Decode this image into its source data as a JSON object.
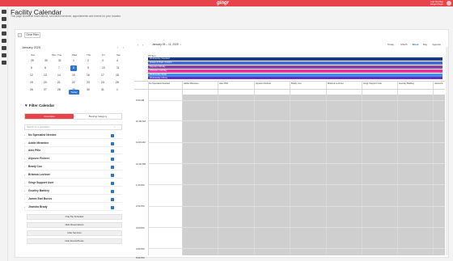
{
  "topbar": {
    "logo": "gingr",
    "user_name": "Lisa Test Rep",
    "user_org": "Ginger Pinger"
  },
  "sidebar": {
    "icons": [
      "home-icon",
      "calendar-icon",
      "paw-icon",
      "inbox-icon",
      "card-icon",
      "chart-icon",
      "heart-icon",
      "settings-icon"
    ]
  },
  "page": {
    "title": "Facility Calendar",
    "subtitle": "This page shows all reservations, scheduled services, appointments and events for your location."
  },
  "toolbar": {
    "expand_label": "›",
    "clear_filter_label": "Clear Filter"
  },
  "mini_calendar": {
    "month_label": "January 2025",
    "prev_glyph": "‹",
    "next_glyph": "›",
    "weekdays": [
      "Sun",
      "Mon",
      "Tue",
      "Wed",
      "Thu",
      "Fri",
      "Sat"
    ],
    "weeks": [
      [
        "29",
        "30",
        "31",
        "1",
        "2",
        "3",
        "4"
      ],
      [
        "5",
        "6",
        "7",
        "8",
        "9",
        "10",
        "11"
      ],
      [
        "12",
        "13",
        "14",
        "15",
        "16",
        "17",
        "18"
      ],
      [
        "19",
        "20",
        "21",
        "22",
        "23",
        "24",
        "25"
      ],
      [
        "26",
        "27",
        "28",
        "29",
        "30",
        "31",
        "1"
      ]
    ],
    "selected_day": "15",
    "today_label": "Today"
  },
  "filter": {
    "title": "Filter Calendar",
    "tab_active": "Associates",
    "tab_inactive": "Booking Category",
    "search_placeholder": "Search for a specialist...",
    "staff": [
      "No Specialist Needed",
      "Addie Miramine",
      "Alex Piltz",
      "Alyssen Fisheer",
      "Brady Cox",
      "Brianna Lochner",
      "Gingr Support User",
      "Gourley Barkley",
      "James Earl Bones",
      "Jharsha Brady"
    ],
    "actions": [
      "Only My Schedule",
      "Hide Reservations",
      "Hide Services",
      "Hide Events/Notes"
    ]
  },
  "calendar": {
    "prev_glyph": "‹",
    "next_glyph": "›",
    "range_label": "January 05 – 11, 2025",
    "dropdown_glyph": "▾",
    "views": [
      "Today",
      "Month",
      "Week",
      "Day",
      "Agenda"
    ],
    "active_view": "Week",
    "day_label": "15 Sun",
    "all_day_events": [
      {
        "label": "Wednesday Standard",
        "color": "#1b3a8c"
      },
      {
        "label": "Groom & Train: 4 Hours",
        "color": "#4c6cc9"
      },
      {
        "label": "Daycare half day",
        "color": "#8b3fa8"
      },
      {
        "label": "Chrissie's Full Day",
        "color": "#e0399a"
      },
      {
        "label": "Wednesday Skate",
        "color": "#3e8ef0"
      },
      {
        "label": "Wednesday Ultima",
        "color": "#6a2fb8"
      }
    ],
    "columns": [
      "No Specialist Needed",
      "Addie Miramine",
      "Alex Piltz",
      "Alyssen Fisheer",
      "Brady Cox",
      "Brianna Lochner",
      "Gingr Support User",
      "Gourley Barkley",
      "James E"
    ],
    "times": [
      "9:00 AM",
      "10:00 AM",
      "11:00 AM",
      "12:00 PM",
      "1:00 PM",
      "2:00 PM",
      "3:00 PM",
      "4:00 PM",
      "5:00 PM"
    ]
  }
}
